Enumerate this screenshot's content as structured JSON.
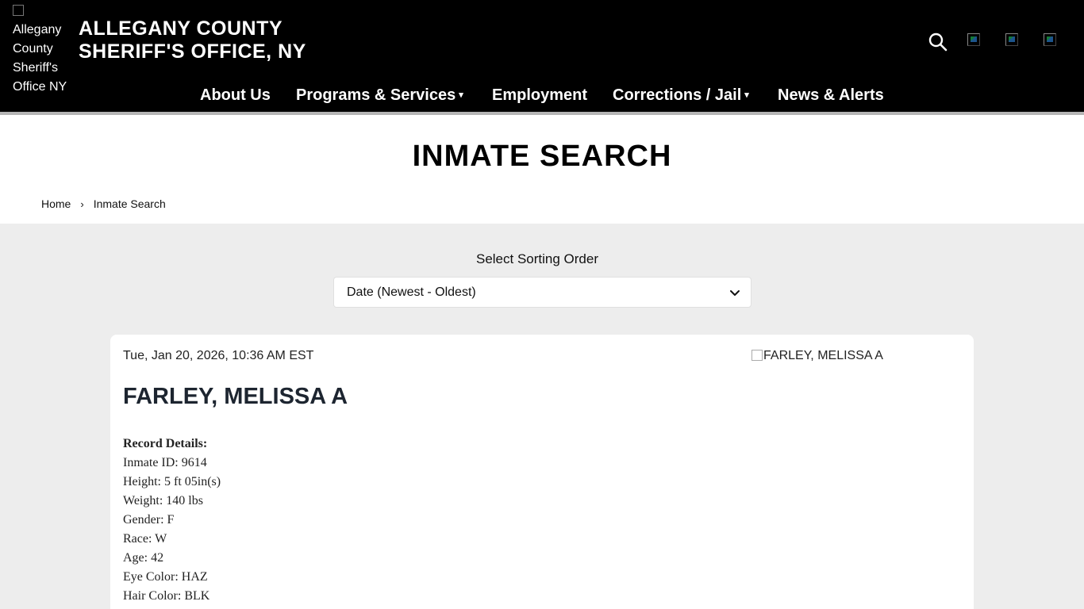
{
  "header": {
    "logo_alt": "Allegany County Sheriff's Office NY",
    "title_line1": "ALLEGANY COUNTY",
    "title_line2": "SHERIFF'S OFFICE, NY",
    "search_icon": "search-icon",
    "social_icons": [
      "social-icon-1",
      "social-icon-2",
      "social-icon-3"
    ]
  },
  "nav": {
    "items": [
      {
        "label": "About Us",
        "dropdown": false
      },
      {
        "label": "Programs & Services",
        "dropdown": true
      },
      {
        "label": "Employment",
        "dropdown": false
      },
      {
        "label": "Corrections / Jail",
        "dropdown": true
      },
      {
        "label": "News & Alerts",
        "dropdown": false
      }
    ],
    "caret": "▾"
  },
  "page": {
    "title": "INMATE SEARCH",
    "breadcrumb": {
      "home": "Home",
      "separator": "›",
      "current": "Inmate Search"
    }
  },
  "sort": {
    "label": "Select Sorting Order",
    "selected": "Date (Newest - Oldest)"
  },
  "record": {
    "date": "Tue, Jan 20, 2026, 10:36 AM EST",
    "photo_alt": "FARLEY, MELISSA A",
    "name": "FARLEY, MELISSA A",
    "details_heading": "Record Details:",
    "details": [
      "Inmate ID: 9614",
      "Height: 5 ft 05in(s)",
      "Weight: 140 lbs",
      "Gender: F",
      "Race: W",
      "Age: 42",
      "Eye Color: HAZ",
      "Hair Color: BLK"
    ]
  },
  "colors": {
    "header_bg": "#000000",
    "page_bg": "#ededed",
    "card_bg": "#ffffff",
    "name_color": "#1d2530"
  }
}
